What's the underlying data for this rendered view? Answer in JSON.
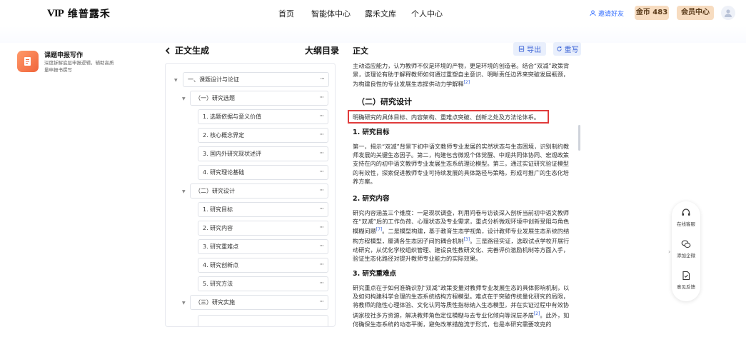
{
  "header": {
    "logo_mark": "VIP",
    "logo_text": "维普露禾",
    "nav": [
      "首页",
      "智能体中心",
      "露禾文库",
      "个人中心"
    ],
    "invite_label": "邀请好友",
    "coin_label": "金币 483",
    "member_label": "会员中心"
  },
  "tool": {
    "title": "课题申报写作",
    "desc": "深度拆解底层申报逻辑，辅助高质量申报书撰写"
  },
  "panels": {
    "back_title": "正文生成",
    "outline_title": "大纲目录",
    "content_title": "正文",
    "export_label": "导出",
    "rewrite_label": "重写"
  },
  "outline": [
    {
      "label": "一、课题设计与论证",
      "level": 0
    },
    {
      "label": "（一）研究选题",
      "level": 1
    },
    {
      "label": "1. 选题依据与意义价值",
      "level": 2
    },
    {
      "label": "2. 核心概念界定",
      "level": 2
    },
    {
      "label": "3. 国内外研究现状述评",
      "level": 2
    },
    {
      "label": "4. 研究理论基础",
      "level": 2
    },
    {
      "label": "（二）研究设计",
      "level": 1
    },
    {
      "label": "1. 研究目标",
      "level": 2
    },
    {
      "label": "2. 研究内容",
      "level": 2
    },
    {
      "label": "3. 研究重难点",
      "level": 2
    },
    {
      "label": "4. 研究创新点",
      "level": 2
    },
    {
      "label": "5. 研究方法",
      "level": 2
    },
    {
      "label": "（三）研究实施",
      "level": 1
    }
  ],
  "content": {
    "intro": "主动适应能力，认为教师不仅是环境的产物，更是环境的创造者。结合“双减”政策背景，该理论有助于解释教师如何通过重塑自主意识、明晰责任边界来突破发展瓶颈，为构建良性的专业发展生态提供动力学解释",
    "intro_ref": "[2]",
    "h2": "（二）研究设计",
    "highlight": "明确研究的具体目标、内容架构、重难点突破、创新之处及方法论体系。",
    "s1_title": "1. 研究目标",
    "s1_text": "第一，揭示“双减”背景下初中语文教师专业发展的实然状态与生态困境，识别制约教师发展的关键生态因子。第二，构建包含微观个体觉醒、中观共同体协同、宏观政策支持在内的初中语文教师专业发展生态系统理论模型。第三，通过实证研究验证模型的有效性，探索促进教师专业可持续发展的具体路径与策略，形成可推广的生态化培养方案。",
    "s2_title": "2. 研究内容",
    "s2_text_a": "研究内容涵盖三个维度：一是现状调查，利用问卷与访谈深入剖析当前初中语文教师在“双减”后的工作负荷、心理状态及专业需求，重点分析微观环境中创新受阻与角色模糊问题",
    "s2_ref1": "[7]",
    "s2_text_b": "。二是模型构建，基于教育生态学视角，设计教师专业发展生态系统的结构方程模型，厘清各生态因子间的耦合机制",
    "s2_ref2": "[3]",
    "s2_text_c": "。三是路径实证，选取试点学校开展行动研究，从优化学校组织管理、建设良性教研文化、完善评价激励机制等方面入手，验证生态化路径对提升教师专业能力的实际效果。",
    "s3_title": "3. 研究重难点",
    "s3_text_a": "研究重点在于如何准确识别“双减”政策变量对教师专业发展生态的具体影响机制，以及如何构建科学合理的生态系统结构方程模型。难点在于突破传统量化研究的局限，将教师的隐性心理体验、文化认同等质性指标纳入生态模型，并在实证过程中有效协调家校社多方资源，解决教师角色定位模糊与去专业化倾向等深层矛盾",
    "s3_ref": "[2]",
    "s3_text_b": "。此外，如何确保生态系统的动态平衡，避免改革措施流于形式，也是本研究需要攻克的"
  },
  "float_menu": [
    "在线客服",
    "添加企微",
    "意见反馈"
  ],
  "icons": {
    "back": "chevron-left-icon",
    "export": "export-icon",
    "rewrite": "refresh-icon",
    "user": "user-icon",
    "invite": "invite-user-icon"
  },
  "colors": {
    "accent": "#3a63d6",
    "highlight_border": "#e03b3b",
    "member_bg": "#f7dcc0",
    "tool_icon": "#f0643a"
  }
}
